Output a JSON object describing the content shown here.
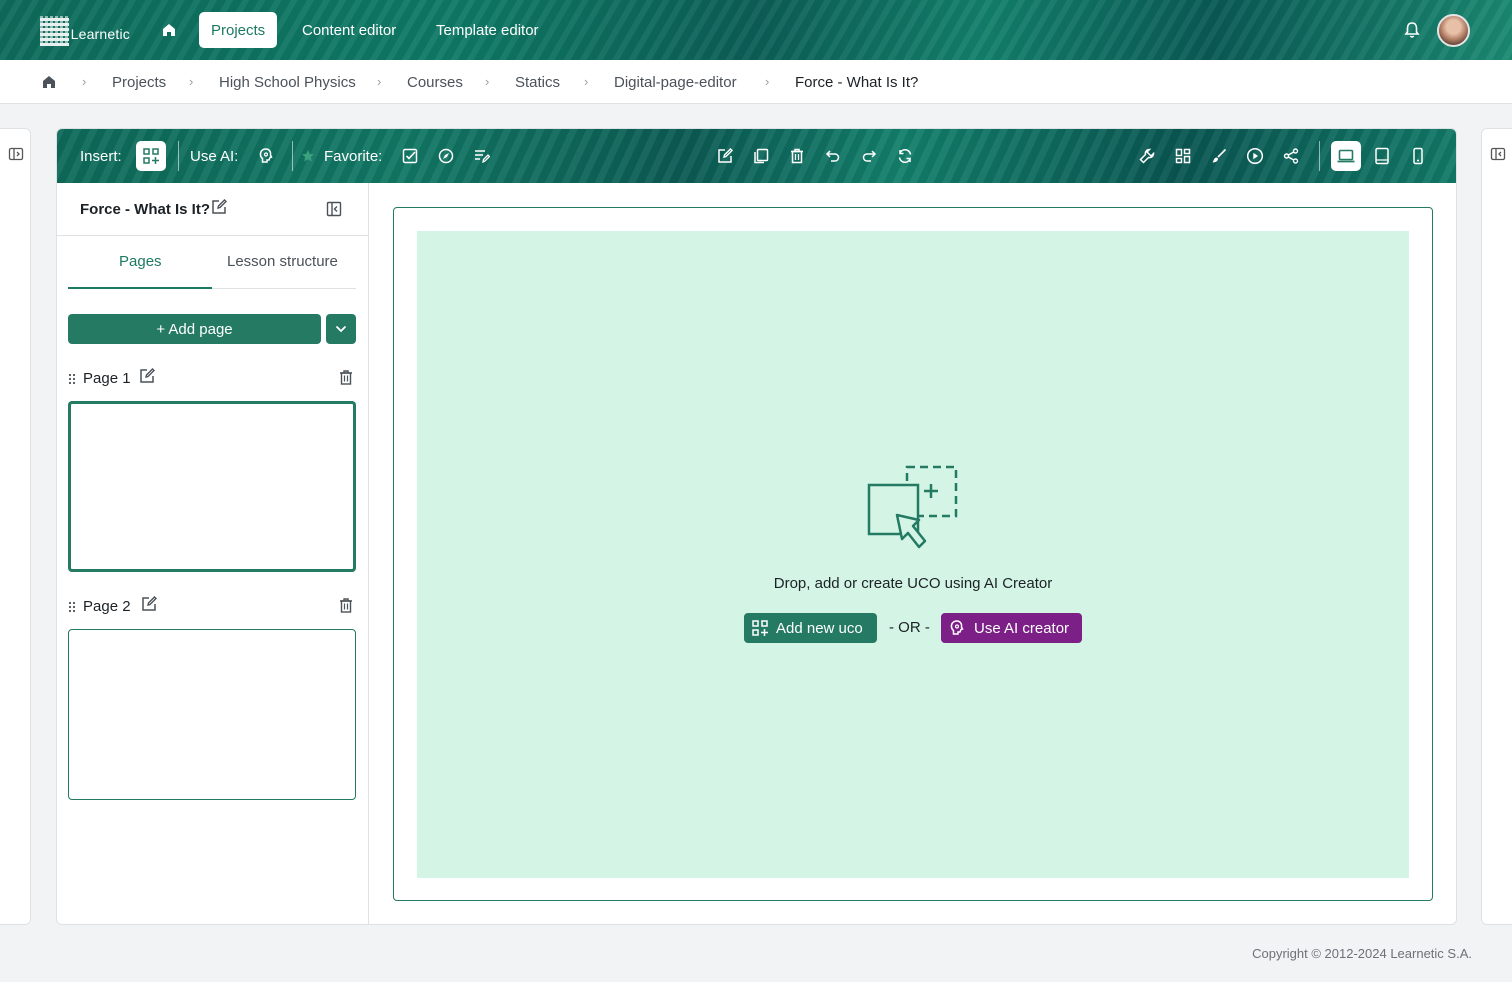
{
  "app": {
    "logo_text": "Learnetic",
    "nav": {
      "projects": "Projects",
      "content_editor": "Content editor",
      "template_editor": "Template editor"
    }
  },
  "breadcrumb": {
    "items": [
      "Projects",
      "High School Physics",
      "Courses",
      "Statics",
      "Digital-page-editor"
    ],
    "current": "Force - What Is It?"
  },
  "toolbar": {
    "insert_label": "Insert:",
    "use_ai_label": "Use AI:",
    "favorite_label": "Favorite:",
    "active_device": "desktop"
  },
  "lesson": {
    "title": "Force - What Is It?",
    "tabs": [
      "Pages",
      "Lesson structure"
    ],
    "active_tab": "Pages",
    "add_page_label": "+ Add page",
    "pages": [
      {
        "label": "Page 1",
        "selected": true
      },
      {
        "label": "Page 2",
        "selected": false
      }
    ]
  },
  "canvas": {
    "drop_text": "Drop, add or create UCO using AI Creator",
    "add_uco_label": "Add new uco",
    "or_label": "- OR -",
    "ai_creator_label": "Use AI creator"
  },
  "colors": {
    "accent": "#247a63",
    "drop_zone": "#d4f4e6",
    "ai_purple": "#7c1f86"
  },
  "footer": {
    "copyright": "Copyright © 2012-2024 Learnetic S.A."
  }
}
